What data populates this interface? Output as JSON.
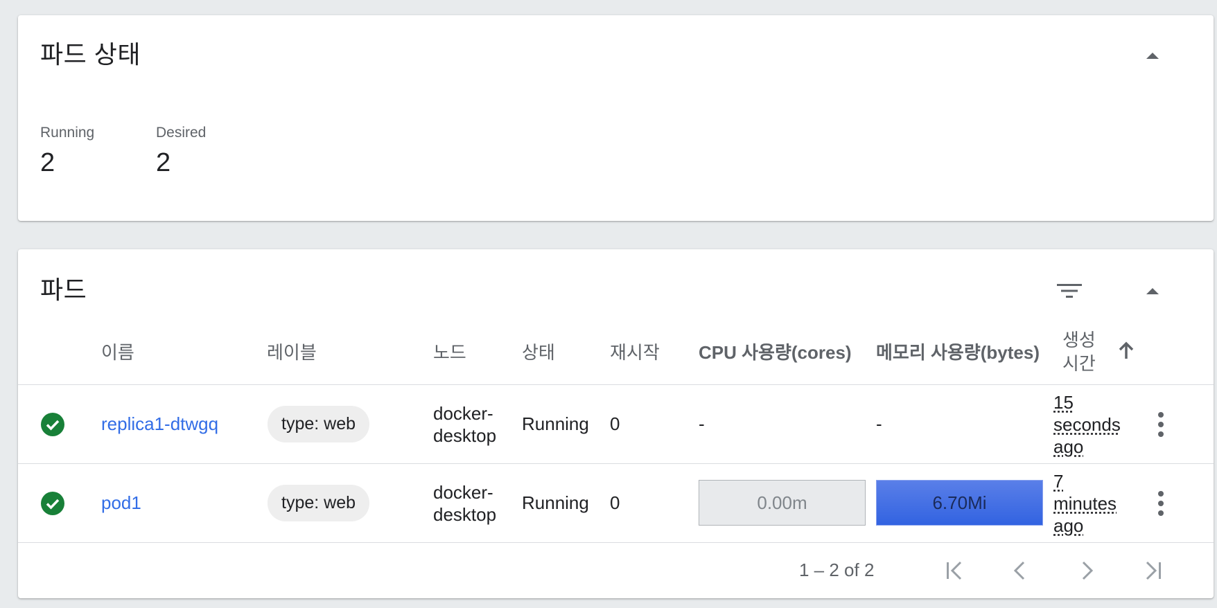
{
  "pod_status": {
    "title": "파드 상태",
    "running_label": "Running",
    "running_value": "2",
    "desired_label": "Desired",
    "desired_value": "2"
  },
  "pods": {
    "title": "파드",
    "columns": {
      "name": "이름",
      "labels": "레이블",
      "node": "노드",
      "status": "상태",
      "restarts": "재시작",
      "cpu": "CPU 사용량(cores)",
      "memory": "메모리 사용량(bytes)",
      "created": "생성 시간"
    },
    "rows": [
      {
        "name": "replica1-dtwgq",
        "label": "type: web",
        "node": "docker-desktop",
        "status": "Running",
        "restarts": "0",
        "cpu": "-",
        "memory": "-",
        "age": "15 seconds ago"
      },
      {
        "name": "pod1",
        "label": "type: web",
        "node": "docker-desktop",
        "status": "Running",
        "restarts": "0",
        "cpu": "0.00m",
        "memory": "6.70Mi",
        "age": "7 minutes ago"
      }
    ],
    "range_label": "1 – 2 of 2"
  },
  "colors": {
    "link": "#326de6",
    "success": "#188038",
    "memory_bar": "#3263e1",
    "cpu_bar": "#e8eaec",
    "background": "#e8ebed"
  },
  "icons": {
    "collapse": "chevron-up-icon",
    "filter": "filter-icon",
    "sort": "arrow-up-icon",
    "status": "check-circle-icon",
    "more": "more-vert-icon",
    "first": "first-page-icon",
    "prev": "chevron-left-icon",
    "next": "chevron-right-icon",
    "last": "last-page-icon"
  }
}
